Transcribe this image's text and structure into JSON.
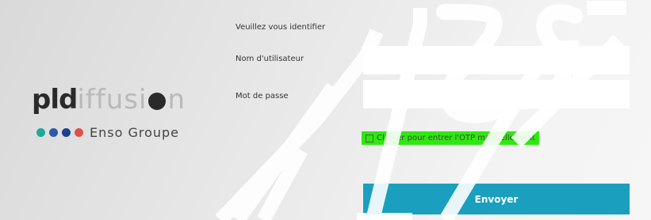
{
  "brand": {
    "logo_part_dark": "pld",
    "logo_part_light": "iffusi",
    "logo_part_end": "n",
    "group_name": "Enso Groupe",
    "dot_colors": [
      "#1fa99b",
      "#2a5aa8",
      "#1e3f8f",
      "#e0514a"
    ]
  },
  "form": {
    "heading": "Veuillez vous identifier",
    "username_label": "Nom d'utilisateur",
    "username_value": "",
    "password_label": "Mot de passe",
    "password_value": "",
    "otp_checkbox_label": "Cliquer pour entrer l'OTP manuellement",
    "otp_checked": false,
    "submit_label": "Envoyer"
  },
  "colors": {
    "submit_bg": "#1a9fbf",
    "otp_highlight": "#2ee80f"
  },
  "watermark": {
    "text": "ENSO",
    "color": "#ffffff"
  }
}
